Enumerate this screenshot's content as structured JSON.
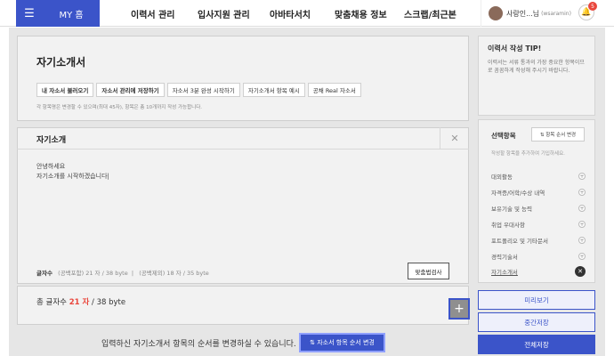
{
  "topbar": {
    "my_home": "MY 홈",
    "nav": [
      "이력서 관리",
      "입사지원 관리",
      "아바타서치",
      "맞춤채용 정보",
      "스크랩/최근본"
    ],
    "user_name": "사랑인...님",
    "user_id": "(wsaramin)",
    "notifications": "5"
  },
  "editor": {
    "page_title": "자기소개서",
    "buttons": [
      "내 자소서 불러오기",
      "자소서 관리에 저장하기",
      "자소서 3분 완성 시작하기",
      "자기소개서 항목 예시",
      "공채 Real 자소서"
    ],
    "hint": "각 항목명은 변경할 수 있으며(최대 45자), 항목은 총 10개까지 작성 가능합니다.",
    "section_title": "자기소개",
    "body_lines": [
      "안녕하세요",
      "자기소개를 시작하겠습니다|"
    ],
    "char_label": "글자수",
    "char_with_space": "(공백포함) 21 자 / 38 byte",
    "char_without_space": "(공백제외) 18 자 / 35 byte",
    "spell_check": "맞춤법검사",
    "total_prefix": "총 글자수",
    "total_chars": "21 자",
    "total_bytes": "/ 38 byte",
    "order_text": "입력하신 자기소개서 항목의 순서를 변경하실 수 있습니다.",
    "order_button": "⇅ 자소서 항목 순서 변경"
  },
  "sidebar": {
    "tip_title": "이력서 작성 TIP!",
    "tip_body": "이력서는 서류 통과의 가장 중요한 항목이므로 꼼꼼하게 작성해 주시기 바랍니다.",
    "select_title": "선택항목",
    "change_order": "⇅ 항목 순서 변경",
    "select_sub": "작성할 항목을 추가하여 기입하세요.",
    "items": [
      "대외활동",
      "자격증/어학/수상 내역",
      "보유기술 및 능력",
      "취업 우대사항",
      "포트폴리오 및 기타문서",
      "경력기술서",
      "자기소개서"
    ],
    "preview": "미리보기",
    "temp_save": "중간저장",
    "save_all": "전체저장"
  },
  "colors": {
    "accent": "#3b54c9",
    "red": "#e9463c"
  }
}
